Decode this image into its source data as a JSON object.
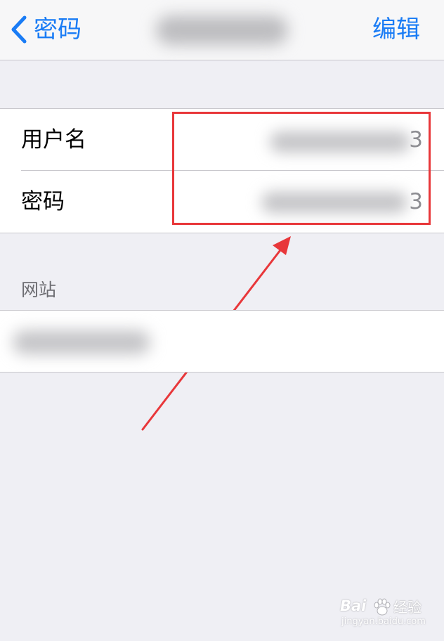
{
  "nav": {
    "back_label": "密码",
    "edit_label": "编辑"
  },
  "credentials": {
    "username_label": "用户名",
    "username_suffix": "3",
    "password_label": "密码",
    "password_suffix": "3"
  },
  "website_section": {
    "header": "网站"
  },
  "watermark": {
    "brand": "Bai",
    "brand_suffix": "经验",
    "url": "jingyan.baidu.com"
  },
  "colors": {
    "accent": "#1a7cf5",
    "annotation": "#e8373a",
    "background": "#efeff4"
  },
  "icons": {
    "back": "chevron-left-icon",
    "annotation_arrow": "arrow-icon",
    "watermark_paw": "paw-icon"
  }
}
